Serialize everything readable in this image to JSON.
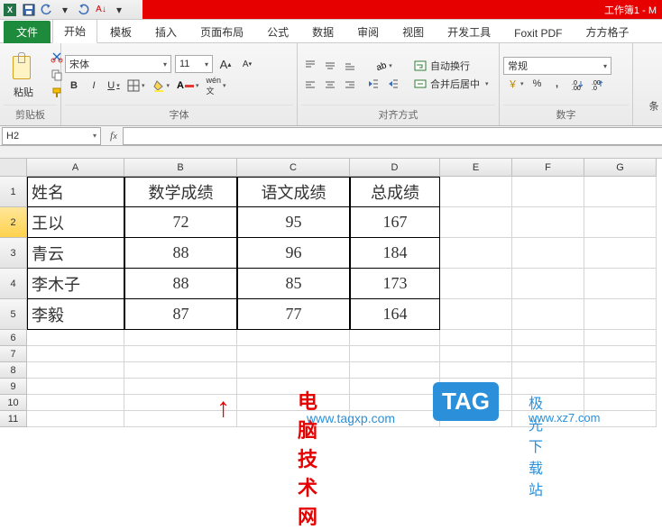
{
  "window": {
    "workbook_title": "工作簿1 - M"
  },
  "qat": {
    "save": "💾",
    "undo": "↶",
    "redo": "↷",
    "sort": "A↓"
  },
  "tabs": {
    "file": "文件",
    "items": [
      {
        "label": "开始",
        "active": true
      },
      {
        "label": "模板"
      },
      {
        "label": "插入"
      },
      {
        "label": "页面布局"
      },
      {
        "label": "公式"
      },
      {
        "label": "数据"
      },
      {
        "label": "审阅"
      },
      {
        "label": "视图"
      },
      {
        "label": "开发工具"
      },
      {
        "label": "Foxit PDF"
      },
      {
        "label": "方方格子"
      }
    ]
  },
  "ribbon": {
    "clipboard": {
      "paste": "粘贴",
      "label": "剪贴板"
    },
    "font": {
      "name": "宋体",
      "size": "11",
      "grow": "A",
      "shrink": "A",
      "b": "B",
      "i": "I",
      "u": "U",
      "label": "字体"
    },
    "align": {
      "wrap": "自动换行",
      "merge": "合并后居中",
      "label": "对齐方式"
    },
    "number": {
      "format": "常规",
      "label": "数字"
    },
    "side": "条"
  },
  "cellref": {
    "name": "H2"
  },
  "columns": [
    "A",
    "B",
    "C",
    "D",
    "E",
    "F",
    "G"
  ],
  "rows": [
    "1",
    "2",
    "3",
    "4",
    "5",
    "6",
    "7",
    "8",
    "9",
    "10",
    "11"
  ],
  "chart_data": {
    "type": "table",
    "headers": [
      "姓名",
      "数学成绩",
      "语文成绩",
      "总成绩"
    ],
    "rows": [
      {
        "name": "王以",
        "math": 72,
        "chinese": 95,
        "total": 167
      },
      {
        "name": "青云",
        "math": 88,
        "chinese": 96,
        "total": 184
      },
      {
        "name": "李木子",
        "math": 88,
        "chinese": 85,
        "total": 173
      },
      {
        "name": "李毅",
        "math": 87,
        "chinese": 77,
        "total": 164
      }
    ]
  },
  "watermark": {
    "text1": "电脑技术网",
    "url1": "www.tagxp.com",
    "tag": "TAG",
    "text2": "极光下载站",
    "url2": "www.xz7.com"
  }
}
